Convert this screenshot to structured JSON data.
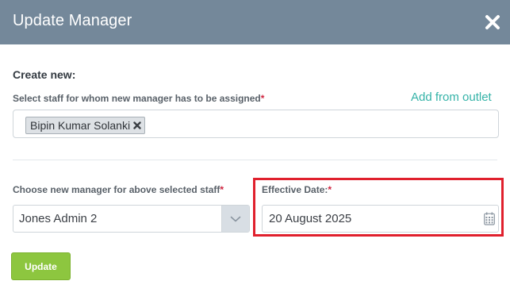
{
  "dialog": {
    "title": "Update Manager",
    "close_icon": "close-icon"
  },
  "create_section": {
    "heading": "Create new:",
    "staff_label": "Select staff for whom new manager has to be assigned",
    "required_mark": "*",
    "add_from_outlet_link": "Add from outlet",
    "selected_staff": [
      {
        "name": "Bipin Kumar Solanki",
        "remove_icon": "remove-tag-icon"
      }
    ]
  },
  "manager_field": {
    "label": "Choose new manager for above selected staff",
    "required_mark": "*",
    "value": "Jones Admin 2",
    "arrow_icon": "chevron-down-icon"
  },
  "date_field": {
    "label": "Effective Date:",
    "required_mark": "*",
    "value": "20 August 2025",
    "icon": "calendar-icon"
  },
  "actions": {
    "update_label": "Update"
  },
  "colors": {
    "header_bg": "#74889a",
    "link": "#35b3a8",
    "required": "#d0243f",
    "primary_button": "#8dc63f",
    "highlight_box": "#e0202d"
  }
}
